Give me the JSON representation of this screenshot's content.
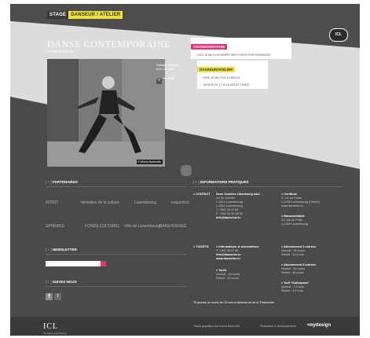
{
  "nav": {
    "tab1": "STAGE",
    "tab2": "DANSEUR / ATELIER"
  },
  "header": {
    "title": "DANSE CONTEMPORAINE",
    "subtitle": "Mi-Tamas Kaolin"
  },
  "photo": {
    "credit": "© Mireia Badenolis"
  },
  "side": {
    "text": "Partagez cet article avec vos amis",
    "button": "+"
  },
  "badge": "ICL",
  "schedule1": {
    "head": "CHOREOGRAPHIE",
    "line": "··· 13/03 16 Ma 14:00 MARRO BROTHERS PERFORMANCES"
  },
  "schedule2": {
    "head": "DANSEUR/ATELIER",
    "line1": "··· 13/03 16 Ma 15:00 LA MOLAY",
    "line2": "··· 18/03/16 Fri 17:30 LA MOLAY TANZE"
  },
  "partners": {
    "title": "PARTENAIRES",
    "marker": "[ + ]",
    "logos": [
      "INTRO",
      "ministère de la culture",
      "Luxembourg",
      "coquelicot",
      "SPHERES",
      "FONDS CULTUREL",
      "Ville de Luxembourg",
      "BAKEHOUSES"
    ]
  },
  "newsletter": {
    "title": "NEWSLETTER",
    "marker": "[ + ]"
  },
  "follow": {
    "title": "SUIVEZ-NOUS",
    "marker": "[ + ]",
    "facebook": "f",
    "twitter": "t"
  },
  "info": {
    "title": "INFORMATIONS PRATIQUES",
    "marker": "[ + ]",
    "contact_label": "> CONTACT",
    "contact_lines": [
      "Neue Yasmine Lëtzebuerg asbl",
      "c/o 3e chemin",
      "L-1614 Luxembourg",
      "L-4511 Luxembourg",
      "T: +352 26 47 88",
      "F: +352 26 49 88 55",
      "info@danselux.lu"
    ],
    "pass_label": "Certificat",
    "pass_lines": [
      "> Certificat",
      "3, rue du Fossé",
      "L-1536 Luxembourg (Centre)",
      "www.danselux.lu"
    ],
    "venue_label": "> Banannefabrik",
    "venue_lines": [
      "> Banannefabrik",
      "12, rue du Puits",
      "L-2355 Luxembourg"
    ],
    "booking_label": "> TICKETS",
    "booking_lines": [
      "> Informations et réservations",
      "T: +352 26 47 88",
      "info@danselux.lu",
      "www.danselux.lu"
    ],
    "price_label": "> Tarifs",
    "price_lines": [
      "Normal : 15 euros",
      "Réduit : 10 euros"
    ],
    "sub1_lines": [
      "> Abonnement 3 entrées",
      "Normal : 36 euros",
      "Réduit : 24 euros"
    ],
    "sub2_lines": [
      "> Abonnement 5 entrées",
      "Normal : 55 euros",
      "Réduit : 35 euros"
    ],
    "card_lines": [
      "> Tarif \"Kulturpass\"",
      "Normal : 1,5 euro",
      "Réduit : 1,5 euro"
    ],
    "note": "Tri jeunes de moins de 26 ans et détenteurs de la 'Passerelle'."
  },
  "footer": {
    "logo": "ICL",
    "logo_sub": "ICL Danse Luxembourg",
    "center": "Thank graphique par Mireia Badenolis",
    "center2": "Réalisation & développement",
    "brand": "•mydesign"
  }
}
